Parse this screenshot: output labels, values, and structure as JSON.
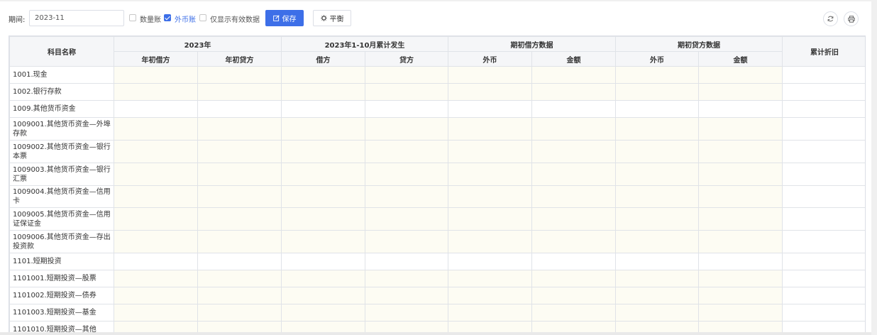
{
  "toolbar": {
    "period_label": "期间:",
    "period_value": "2023-11",
    "checkboxes": [
      {
        "label": "数量账",
        "checked": false
      },
      {
        "label": "外币账",
        "checked": true
      },
      {
        "label": "仅显示有效数据",
        "checked": false
      }
    ],
    "save_label": "保存",
    "balance_label": "平衡",
    "refresh_icon": "refresh-icon",
    "print_icon": "print-icon"
  },
  "colors": {
    "primary": "#3d6fe8",
    "editable_cell": "#fdfcf3",
    "header_bg": "#f5f6f8",
    "border": "#e0e3e8"
  },
  "table": {
    "header_groups": {
      "subject": "科目名称",
      "year": "2023年",
      "accum": "2023年1-10月累计发生",
      "init_debit": "期初借方数据",
      "init_credit": "期初贷方数据",
      "depreciation": "累计折旧"
    },
    "sub_headers": {
      "year_debit": "年初借方",
      "year_credit": "年初贷方",
      "accum_debit": "借方",
      "accum_credit": "贷方",
      "debit_fc": "外币",
      "debit_amount": "金额",
      "credit_fc": "外币",
      "credit_amount": "金额"
    },
    "rows": [
      {
        "name": "1001.现金",
        "tall": false,
        "editable": true
      },
      {
        "name": "1002.银行存款",
        "tall": false,
        "editable": true
      },
      {
        "name": "1009.其他货币资金",
        "tall": false,
        "editable": false
      },
      {
        "name": "1009001.其他货币资金—外埠存款",
        "tall": true,
        "editable": true
      },
      {
        "name": "1009002.其他货币资金—银行本票",
        "tall": true,
        "editable": true
      },
      {
        "name": "1009003.其他货币资金—银行汇票",
        "tall": true,
        "editable": true
      },
      {
        "name": "1009004.其他货币资金—信用卡",
        "tall": false,
        "editable": true
      },
      {
        "name": "1009005.其他货币资金—信用证保证金",
        "tall": true,
        "editable": true
      },
      {
        "name": "1009006.其他货币资金—存出投资款",
        "tall": true,
        "editable": true
      },
      {
        "name": "1101.短期投资",
        "tall": false,
        "editable": false
      },
      {
        "name": "1101001.短期投资—股票",
        "tall": false,
        "editable": true
      },
      {
        "name": "1101002.短期投资—债券",
        "tall": false,
        "editable": true
      },
      {
        "name": "1101003.短期投资—基金",
        "tall": false,
        "editable": true
      },
      {
        "name": "1101010.短期投资—其他",
        "tall": false,
        "editable": true
      }
    ]
  }
}
